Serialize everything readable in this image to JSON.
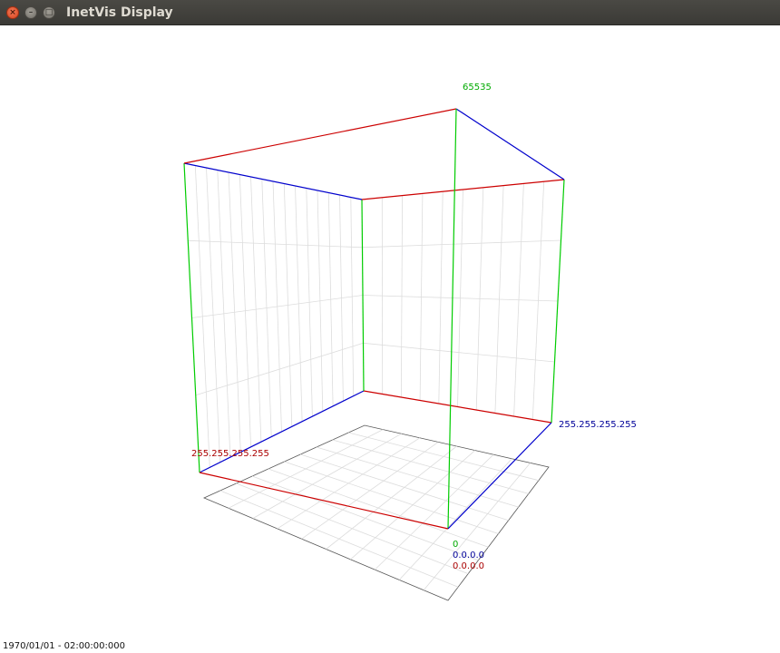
{
  "window": {
    "title": "InetVis Display",
    "close_icon": "close-icon",
    "minimize_icon": "minimize-icon",
    "maximize_icon": "maximize-icon"
  },
  "plot": {
    "port_max_label": "65535",
    "port_min_label": "0",
    "dest_ip_max_label": "255.255.255.255",
    "dest_ip_min_label": "0.0.0.0",
    "src_ip_max_label": "255.255.255.255",
    "src_ip_min_label": "0.0.0.0",
    "colors": {
      "src_axis": "#cc0000",
      "dest_axis": "#0000cc",
      "port_axis": "#00cc00",
      "grid": "#dcdcdc",
      "floor_outline": "#555555"
    }
  },
  "status": {
    "time_label": "1970/01/01 - 02:00:00:000"
  }
}
